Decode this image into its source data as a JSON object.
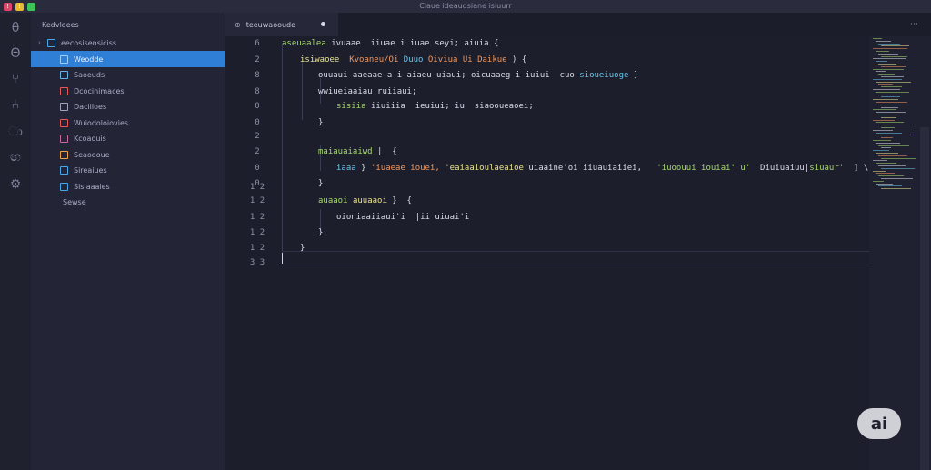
{
  "window": {
    "title": "Claue ideaudsiane isiuurr"
  },
  "title_bar": {
    "buttons": [
      {
        "name": "close",
        "glyph": "!",
        "color": "#e0456b"
      },
      {
        "name": "minimize",
        "glyph": "!",
        "color": "#e8b834"
      },
      {
        "name": "maximize",
        "glyph": "",
        "color": "#3cc35a"
      }
    ]
  },
  "activity_bar": {
    "icons": [
      "explorer-icon",
      "search-icon",
      "source-control-icon",
      "debug-icon",
      "extensions-icon",
      "remote-icon",
      "settings-icon"
    ]
  },
  "sidebar": {
    "header": "Kedvloees",
    "root_folder": "eecosisensiciss",
    "items": [
      {
        "label": "Weodde",
        "icon_color": "#9ad0ff",
        "active": true
      },
      {
        "label": "Saoeuds",
        "icon_color": "#6ab0e8",
        "active": false
      },
      {
        "label": "Dcocinimaces",
        "icon_color": "#e35a5a",
        "active": false
      },
      {
        "label": "Daciiloes",
        "icon_color": "#a0a4bd",
        "active": false
      },
      {
        "label": "Wuiodoloiovies",
        "icon_color": "#e35a5a",
        "active": false
      },
      {
        "label": "Kcoaouis",
        "icon_color": "#c5699e",
        "active": false
      },
      {
        "label": "Seaoooue",
        "icon_color": "#f0a24a",
        "active": false
      },
      {
        "label": "Sireaiues",
        "icon_color": "#4aa8e8",
        "active": false
      },
      {
        "label": "Sisiaaaies",
        "icon_color": "#4aa8e8",
        "active": false
      },
      {
        "label": "Sewse",
        "icon_color": "",
        "active": false
      }
    ]
  },
  "editor_tab": {
    "label": "teeuwaooude",
    "modified": true
  },
  "code": {
    "lines": [
      {
        "num": "6",
        "indent": 0,
        "segments": [
          {
            "t": "aseuaalea ",
            "cls": "g"
          },
          {
            "t": "ivuaae  iiuae i iuae seyi; aiuia ",
            "cls": "w"
          },
          {
            "t": "{",
            "cls": "w"
          }
        ]
      },
      {
        "num": "2",
        "indent": 1,
        "segments": [
          {
            "t": "isiwaoee  ",
            "cls": "y"
          },
          {
            "t": "Kvoaneu/Oi ",
            "cls": "o"
          },
          {
            "t": "Duuo ",
            "cls": "c"
          },
          {
            "t": "Oiviua Ui Daikue ",
            "cls": "o"
          },
          {
            "t": ") {",
            "cls": "w"
          }
        ]
      },
      {
        "num": "8",
        "indent": 2,
        "segments": [
          {
            "t": "ouuaui aaeaae ",
            "cls": "w"
          },
          {
            "t": "a i aiaeu ",
            "cls": "w"
          },
          {
            "t": "uiaui; ",
            "cls": "w"
          },
          {
            "t": "oicuaaeg ",
            "cls": "w"
          },
          {
            "t": "i iuiui  ",
            "cls": "w"
          },
          {
            "t": "cuo ",
            "cls": "w"
          },
          {
            "t": "sioueiuoge",
            "cls": "c"
          },
          {
            "t": " }",
            "cls": "w"
          }
        ]
      },
      {
        "num": "8",
        "indent": 2,
        "segments": [
          {
            "t": "wwiueiaaiau ruiiaui;",
            "cls": "w"
          }
        ]
      },
      {
        "num": "0",
        "indent": 3,
        "segments": [
          {
            "t": "sisiia ",
            "cls": "g"
          },
          {
            "t": "iiuiiia  ieuiui; iu  ",
            "cls": "w"
          },
          {
            "t": "siaooueaoei;",
            "cls": "w"
          }
        ]
      },
      {
        "num": "0",
        "indent": 2,
        "segments": [
          {
            "t": "}",
            "cls": "w"
          }
        ]
      },
      {
        "num": "2",
        "indent": 0,
        "segments": []
      },
      {
        "num": "2",
        "indent": 2,
        "segments": [
          {
            "t": "maiauaiaiwd",
            "cls": "g"
          },
          {
            "t": " |  {",
            "cls": "w"
          }
        ]
      },
      {
        "num": "0",
        "indent": 3,
        "segments": [
          {
            "t": "iaaa",
            "cls": "c"
          },
          {
            "t": " } ",
            "cls": "w"
          },
          {
            "t": "'iuaeae iouei, ",
            "cls": "o"
          },
          {
            "t": "'eaiaaioulaeaioe",
            "cls": "y"
          },
          {
            "t": "'uiaaine'oi ",
            "cls": "w"
          },
          {
            "t": "iiuauiaiiei, ",
            "cls": "w"
          },
          {
            "t": "  'iuoouui iouiai' u'",
            "cls": "g"
          },
          {
            "t": "  Diuiuaiuu|",
            "cls": "w"
          },
          {
            "t": "siuaur'",
            "cls": "g"
          },
          {
            "t": "  ] \\",
            "cls": "w"
          }
        ]
      },
      {
        "num": "0",
        "indent": 2,
        "segments": [
          {
            "t": "}",
            "cls": "w"
          }
        ]
      },
      {
        "num": "",
        "indent": 0,
        "segments": []
      },
      {
        "num": "1 2",
        "indent": 0,
        "segments": []
      },
      {
        "num": "1 2",
        "indent": 2,
        "segments": [
          {
            "t": "auaaoi ",
            "cls": "g"
          },
          {
            "t": "auuaaoi ",
            "cls": "y"
          },
          {
            "t": "}  {",
            "cls": "w"
          }
        ]
      },
      {
        "num": "1 2",
        "indent": 3,
        "segments": [
          {
            "t": "oioniaaiiaui'i ",
            "cls": "w"
          },
          {
            "t": " |ii uiuai'i",
            "cls": "w"
          }
        ]
      },
      {
        "num": "1 2",
        "indent": 2,
        "segments": [
          {
            "t": "}",
            "cls": "w"
          }
        ]
      },
      {
        "num": "1 2",
        "indent": 1,
        "segments": [
          {
            "t": "}",
            "cls": "w"
          }
        ]
      },
      {
        "num": "3 3",
        "indent": 0,
        "segments": []
      }
    ]
  },
  "assistant_badge": {
    "label": "ai"
  }
}
